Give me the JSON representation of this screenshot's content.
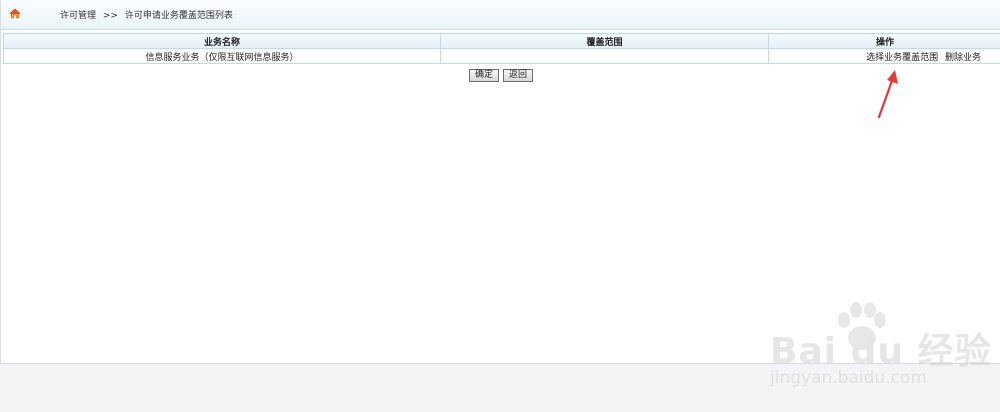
{
  "breadcrumb": {
    "item1": "许可管理",
    "separator": ">>",
    "item2": "许可申请业务覆盖范围列表"
  },
  "table": {
    "headers": [
      "业务名称",
      "覆盖范围",
      "操作"
    ],
    "rows": [
      {
        "business_name": "信息服务业务（仅限互联网信息服务）",
        "coverage": "",
        "actions": [
          "选择业务覆盖范围",
          "删除业务"
        ]
      }
    ]
  },
  "buttons": {
    "confirm": "确定",
    "back": "返回"
  },
  "icons": {
    "home": "home-icon",
    "annotation": "red-arrow"
  },
  "colors": {
    "header_gradient_end": "#eaf4fa",
    "table_border": "#bcdceb",
    "annotation": "#e53935"
  },
  "watermark": {
    "brand": "Bai du 经验",
    "site": "jingyan.baidu.com"
  }
}
